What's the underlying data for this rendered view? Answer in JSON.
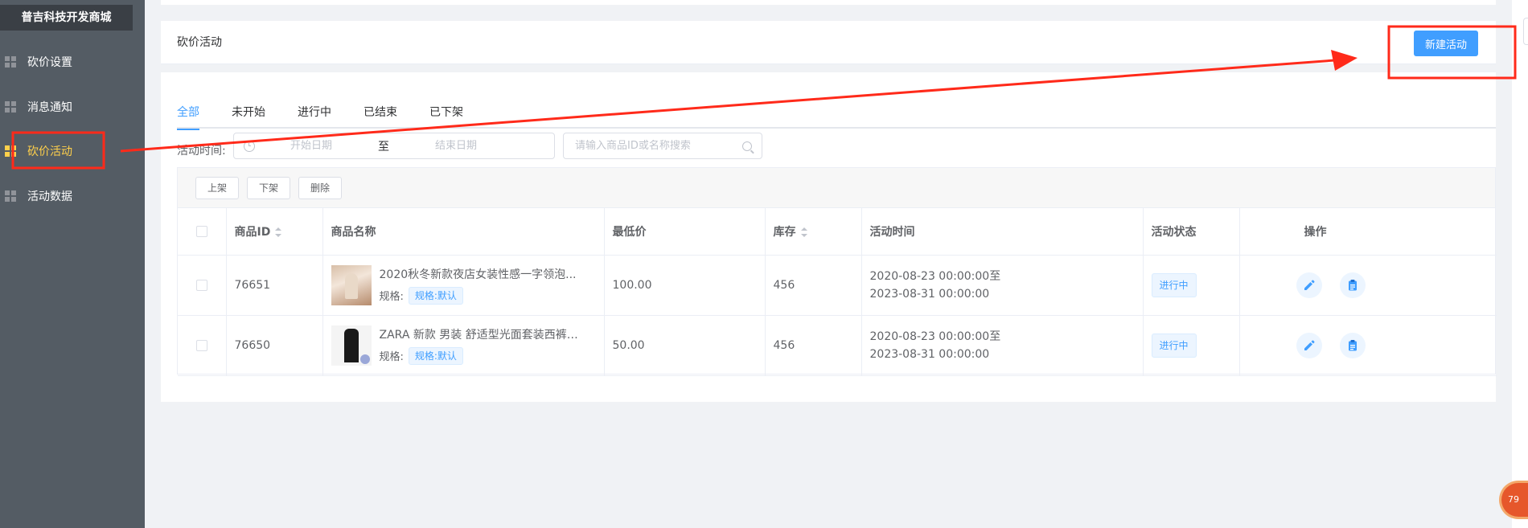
{
  "sidebar": {
    "brand": "普吉科技开发商城",
    "items": [
      {
        "label": "砍价设置"
      },
      {
        "label": "消息通知"
      },
      {
        "label": "砍价活动"
      },
      {
        "label": "活动数据"
      }
    ]
  },
  "header": {
    "title": "砍价活动",
    "new_button": "新建活动"
  },
  "tabs": [
    "全部",
    "未开始",
    "进行中",
    "已结束",
    "已下架"
  ],
  "filters": {
    "time_label": "活动时间:",
    "start_placeholder": "开始日期",
    "separator": "至",
    "end_placeholder": "结束日期",
    "search_placeholder": "请输入商品ID或名称搜索"
  },
  "toolbar": {
    "list_on": "上架",
    "list_off": "下架",
    "delete": "删除"
  },
  "table": {
    "columns": [
      "商品ID",
      "商品名称",
      "最低价",
      "库存",
      "活动时间",
      "活动状态",
      "操作"
    ],
    "rows": [
      {
        "id": "76651",
        "name": "2020秋冬新款夜店女装性感一字领泡...",
        "spec_label": "规格:",
        "spec_value": "规格:默认",
        "price": "100.00",
        "stock": "456",
        "time_start": "2020-08-23 00:00:00至",
        "time_end": "2023-08-31 00:00:00",
        "status": "进行中"
      },
      {
        "id": "76650",
        "name": "ZARA 新款 男装 舒适型光面套装西裤 ...",
        "spec_label": "规格:",
        "spec_value": "规格:默认",
        "price": "50.00",
        "stock": "456",
        "time_start": "2020-08-23 00:00:00至",
        "time_end": "2023-08-31 00:00:00",
        "status": "进行中"
      }
    ]
  },
  "floating_badge": "79",
  "colors": {
    "sidebar_bg": "#545c64",
    "active_menu": "#ffd04b",
    "primary": "#409eff",
    "annotation": "#ff2a1a"
  }
}
